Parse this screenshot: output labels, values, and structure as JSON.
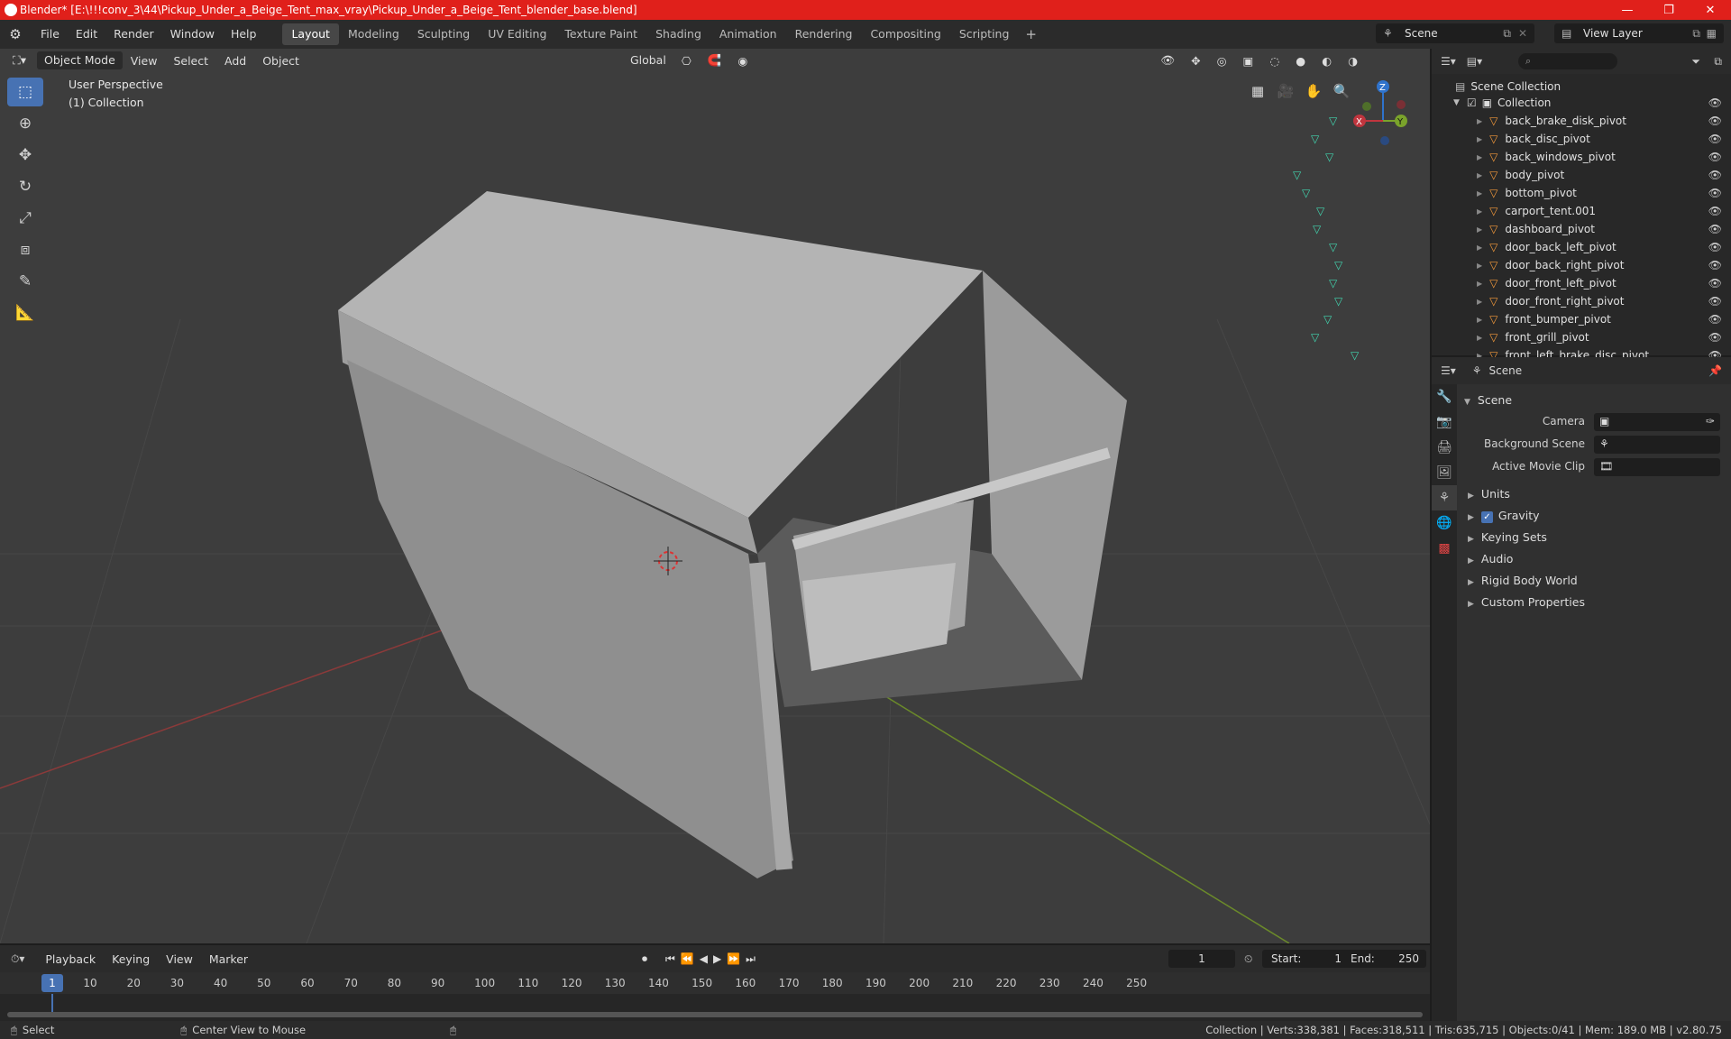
{
  "window": {
    "title": "Blender* [E:\\!!!conv_3\\44\\Pickup_Under_a_Beige_Tent_max_vray\\Pickup_Under_a_Beige_Tent_blender_base.blend]",
    "controls": [
      "—",
      "❐",
      "✕"
    ]
  },
  "menus": [
    "File",
    "Edit",
    "Render",
    "Window",
    "Help"
  ],
  "workspaces": [
    "Layout",
    "Modeling",
    "Sculpting",
    "UV Editing",
    "Texture Paint",
    "Shading",
    "Animation",
    "Rendering",
    "Compositing",
    "Scripting"
  ],
  "active_workspace": "Layout",
  "scene_selector": "Scene",
  "view_layer_selector": "View Layer",
  "viewport": {
    "mode": "Object Mode",
    "menus": [
      "View",
      "Select",
      "Add",
      "Object"
    ],
    "transform_orientation": "Global",
    "info_line1": "User Perspective",
    "info_line2": "(1) Collection",
    "gizmo_axes": {
      "z": "Z",
      "x": "X",
      "y": "Y"
    },
    "colors": {
      "x_axis": "#c0353e",
      "y_axis": "#7aa32b",
      "z_axis": "#2f73cc",
      "active_tool": "#4772b3"
    }
  },
  "outliner": {
    "root": "Scene Collection",
    "collection": "Collection",
    "items": [
      "back_brake_disk_pivot",
      "back_disc_pivot",
      "back_windows_pivot",
      "body_pivot",
      "bottom_pivot",
      "carport_tent.001",
      "dashboard_pivot",
      "door_back_left_pivot",
      "door_back_right_pivot",
      "door_front_left_pivot",
      "door_front_right_pivot",
      "front_bumper_pivot",
      "front_grill_pivot",
      "front_left_brake_disc_pivot"
    ]
  },
  "properties": {
    "context": "Scene",
    "panel": "Scene",
    "fields": {
      "camera": "Camera",
      "background_scene": "Background Scene",
      "active_movie_clip": "Active Movie Clip"
    },
    "sections": [
      "Units",
      "Gravity",
      "Keying Sets",
      "Audio",
      "Rigid Body World",
      "Custom Properties"
    ],
    "gravity_checked": true
  },
  "timeline": {
    "menus": [
      "Playback",
      "Keying",
      "View",
      "Marker"
    ],
    "current_frame": "1",
    "start_label": "Start:",
    "start": "1",
    "end_label": "End:",
    "end": "250",
    "ticks": [
      "1",
      "10",
      "20",
      "30",
      "40",
      "50",
      "60",
      "70",
      "80",
      "90",
      "100",
      "110",
      "120",
      "130",
      "140",
      "150",
      "160",
      "170",
      "180",
      "190",
      "200",
      "210",
      "220",
      "230",
      "240",
      "250"
    ]
  },
  "statusbar": {
    "left1": "Select",
    "left2": "Center View to Mouse",
    "stats": "Collection | Verts:338,381 | Faces:318,511 | Tris:635,715 | Objects:0/41 | Mem: 189.0 MB | v2.80.75"
  }
}
